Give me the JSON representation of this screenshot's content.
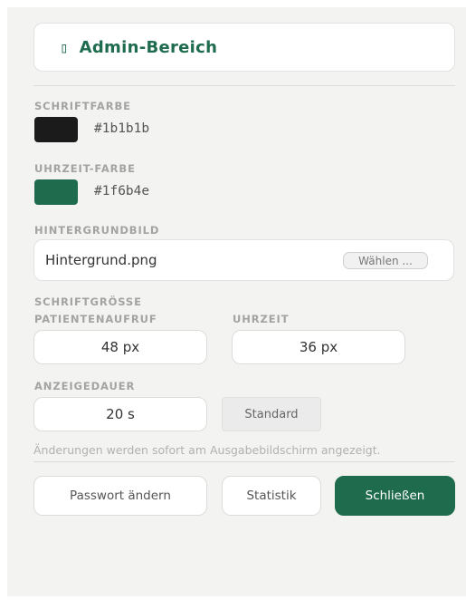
{
  "header": {
    "icon": "placeholder-box-icon",
    "icon_glyph": "▯",
    "title": "Admin-Bereich"
  },
  "font_color": {
    "label": "SCHRIFTFARBE",
    "value": "#1b1b1b"
  },
  "time_color": {
    "label": "UHRZEIT-FARBE",
    "value": "#1f6b4e"
  },
  "background_image": {
    "label": "HINTERGRUNDBILD",
    "filename": "Hintergrund.png",
    "choose_label": "Wählen ..."
  },
  "font_size": {
    "label": "SCHRIFTGRÖSSE",
    "patient_call": {
      "label": "PATIENTENAUFRUF",
      "value": "48 px"
    },
    "time": {
      "label": "UHRZEIT",
      "value": "36 px"
    }
  },
  "display_duration": {
    "label": "ANZEIGEDAUER",
    "value": "20 s",
    "default_label": "Standard"
  },
  "hint": "Änderungen werden sofort am Ausgabebildschirm angezeigt.",
  "actions": {
    "change_password": "Passwort ändern",
    "statistics": "Statistik",
    "close": "Schließen"
  },
  "colors": {
    "accent": "#1f6b4e",
    "panel_bg": "#f3f3f1"
  }
}
